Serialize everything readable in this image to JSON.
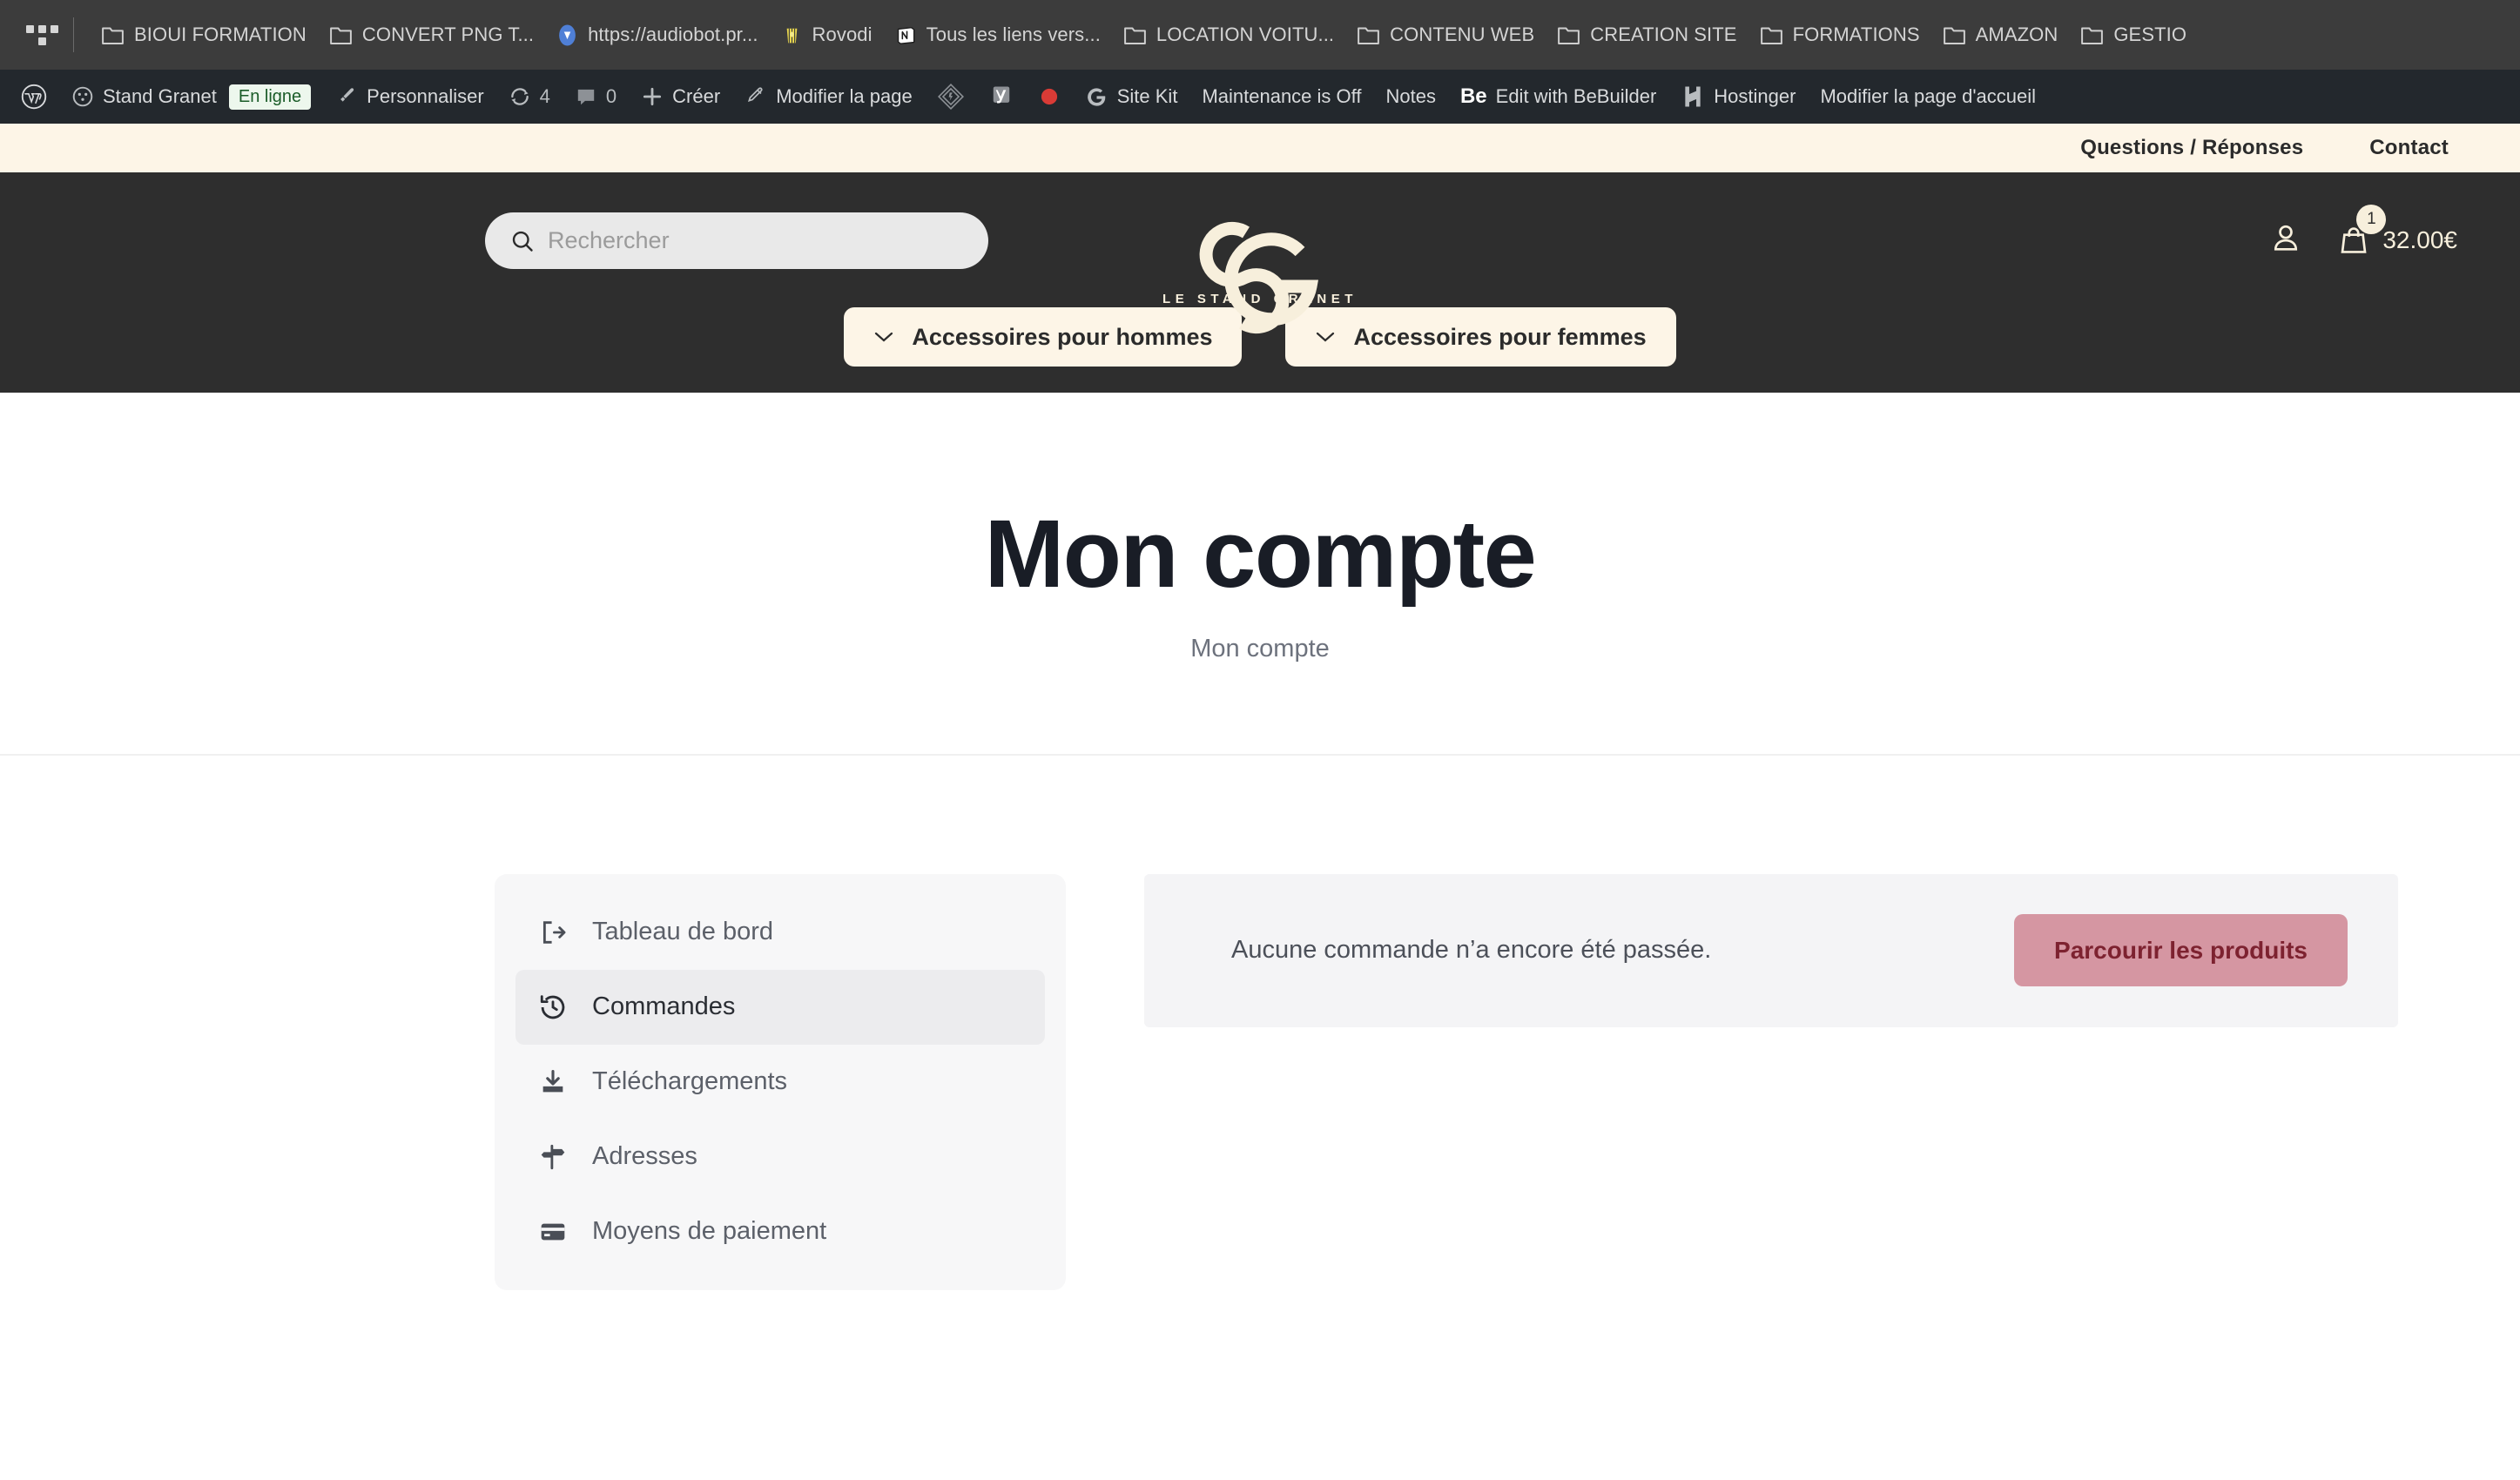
{
  "browser": {
    "apps_icon": "apps-grid-icon",
    "bookmarks": [
      {
        "label": "BIOUI FORMATION",
        "icon": "folder-icon"
      },
      {
        "label": "CONVERT PNG T...",
        "icon": "folder-icon"
      },
      {
        "label": "https://audiobot.pr...",
        "icon": "vimeo-favicon"
      },
      {
        "label": "Rovodi",
        "icon": "popcorn-favicon"
      },
      {
        "label": "Tous les liens vers...",
        "icon": "notion-favicon"
      },
      {
        "label": "LOCATION VOITU...",
        "icon": "folder-icon"
      },
      {
        "label": "CONTENU WEB",
        "icon": "folder-icon"
      },
      {
        "label": "CREATION SITE",
        "icon": "folder-icon"
      },
      {
        "label": "FORMATIONS",
        "icon": "folder-icon"
      },
      {
        "label": "AMAZON",
        "icon": "folder-icon"
      },
      {
        "label": "GESTIO",
        "icon": "folder-icon"
      }
    ]
  },
  "wp_adminbar": {
    "logo": "wordpress-icon",
    "site_name": "Stand Granet",
    "online_badge": "En ligne",
    "customize": "Personnaliser",
    "updates_count": "4",
    "comments_count": "0",
    "new": "Créer",
    "edit_page": "Modifier la page",
    "elementor": "elementor-icon",
    "yoast": "yoast-icon",
    "rec_dot": "red-dot-icon",
    "site_kit": "Site Kit",
    "maintenance": "Maintenance is Off",
    "notes": "Notes",
    "bebuilder": "Edit with BeBuilder",
    "bebuilder_mark": "Be",
    "hostinger": "Hostinger",
    "edit_home": "Modifier la page d'accueil"
  },
  "topbar": {
    "links": [
      {
        "label": "Questions / Réponses"
      },
      {
        "label": "Contact"
      }
    ]
  },
  "header": {
    "search": {
      "placeholder": "Rechercher",
      "value": "",
      "icon": "search-icon"
    },
    "logo": {
      "monogram": "SG",
      "text": "LE STAND GRANET"
    },
    "account_icon": "user-icon",
    "cart": {
      "icon": "shopping-bag-icon",
      "badge": "1",
      "total": "32.00€"
    },
    "categories": [
      {
        "label": "Accessoires pour hommes",
        "icon": "chevron-down-icon"
      },
      {
        "label": "Accessoires pour femmes",
        "icon": "chevron-down-icon"
      }
    ]
  },
  "hero": {
    "title": "Mon compte",
    "breadcrumb": "Mon compte"
  },
  "account": {
    "nav": [
      {
        "label": "Tableau de bord",
        "icon": "dashboard-icon",
        "active": false
      },
      {
        "label": "Commandes",
        "icon": "history-clock-icon",
        "active": true
      },
      {
        "label": "Téléchargements",
        "icon": "download-icon",
        "active": false
      },
      {
        "label": "Adresses",
        "icon": "signpost-icon",
        "active": false
      },
      {
        "label": "Moyens de paiement",
        "icon": "credit-card-icon",
        "active": false
      }
    ],
    "notice": {
      "text": "Aucune commande n’a encore été passée.",
      "button": "Parcourir les produits"
    }
  },
  "colors": {
    "cream": "#fdf5e7",
    "dark_header": "#2e2e2e",
    "browser_bar": "#3c3c3c",
    "wp_bar": "#23282d",
    "rose_button": "#d596a2",
    "rose_button_text": "#7d2230",
    "title": "#191d26"
  }
}
